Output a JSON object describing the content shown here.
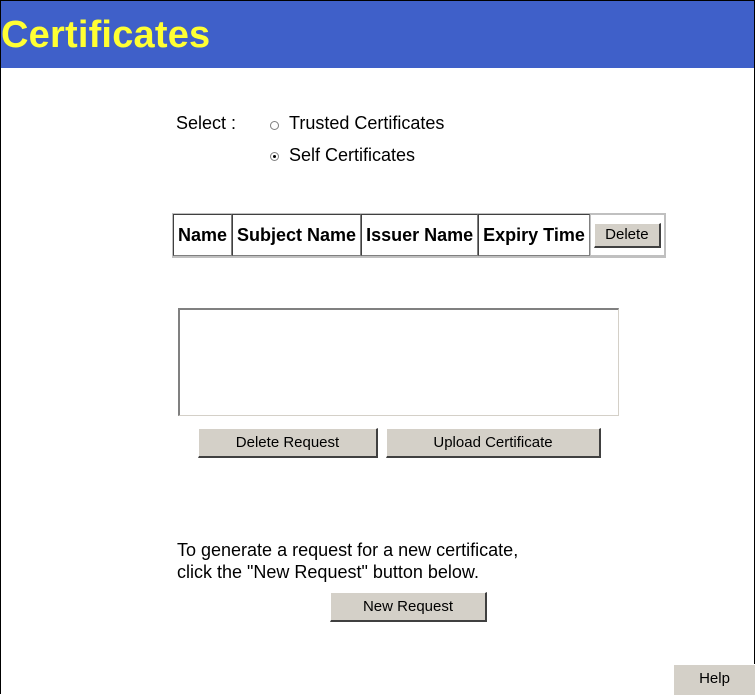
{
  "header": {
    "title": "Certificates"
  },
  "select": {
    "label": "Select :",
    "options": [
      {
        "label": "Trusted Certificates",
        "checked": false
      },
      {
        "label": "Self Certificates",
        "checked": true
      }
    ]
  },
  "table": {
    "columns": [
      "Name",
      "Subject Name",
      "Issuer Name",
      "Expiry Time"
    ],
    "delete_label": "Delete"
  },
  "request": {
    "delete_request_label": "Delete Request",
    "upload_certificate_label": "Upload Certificate"
  },
  "instructions": {
    "line1": "To generate a request for a new certificate,",
    "line2": "click the \"New Request\" button below."
  },
  "new_request_label": "New Request",
  "help_label": "Help",
  "colors": {
    "header_bg": "#3f60c9",
    "header_text": "#ffff33",
    "button_bg": "#d4d0c8"
  }
}
